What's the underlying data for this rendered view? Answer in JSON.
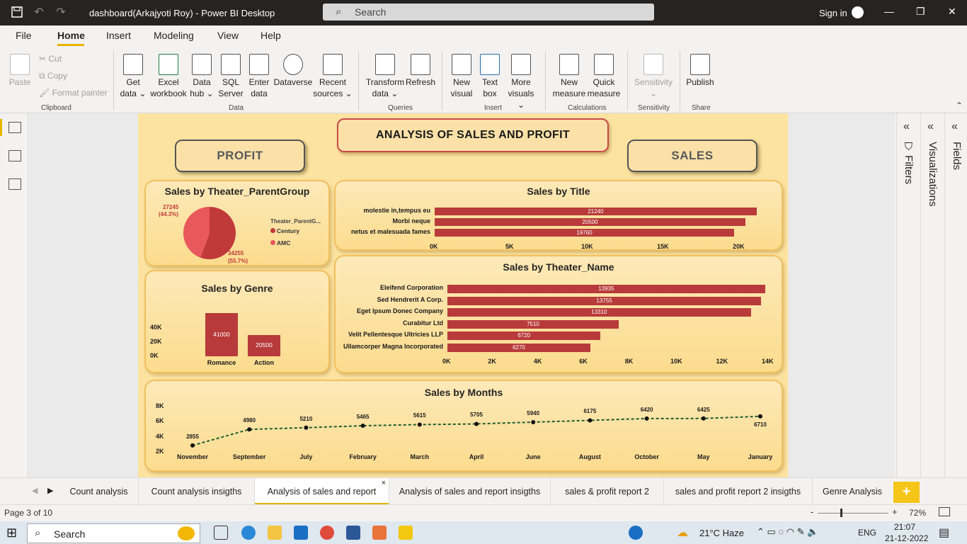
{
  "window": {
    "title": "dashboard(Arkajyoti Roy) - Power BI Desktop",
    "search_placeholder": "Search",
    "sign_in": "Sign in"
  },
  "menu": [
    "File",
    "Home",
    "Insert",
    "Modeling",
    "View",
    "Help"
  ],
  "ribbon": {
    "clipboard": {
      "paste": "Paste",
      "cut": "Cut",
      "copy": "Copy",
      "format_painter": "Format painter",
      "group": "Clipboard"
    },
    "data": {
      "get_data": [
        "Get",
        "data ⌄"
      ],
      "excel": [
        "Excel",
        "workbook"
      ],
      "data_hub": [
        "Data",
        "hub ⌄"
      ],
      "sql": [
        "SQL",
        "Server"
      ],
      "enter": [
        "Enter",
        "data"
      ],
      "dataverse": [
        "Dataverse",
        ""
      ],
      "recent": [
        "Recent",
        "sources ⌄"
      ],
      "group": "Data"
    },
    "queries": {
      "transform": [
        "Transform",
        "data ⌄"
      ],
      "refresh": [
        "Refresh",
        ""
      ],
      "group": "Queries"
    },
    "insert": {
      "new_visual": [
        "New",
        "visual"
      ],
      "text_box": [
        "Text",
        "box"
      ],
      "more_visuals": [
        "More",
        "visuals ⌄"
      ],
      "group": "Insert"
    },
    "calculations": {
      "new_measure": [
        "New",
        "measure"
      ],
      "quick_measure": [
        "Quick",
        "measure"
      ],
      "group": "Calculations"
    },
    "sensitivity": {
      "sensitivity": [
        "Sensitivity",
        "⌄"
      ],
      "group": "Sensitivity"
    },
    "share": {
      "publish": [
        "Publish",
        ""
      ],
      "group": "Share"
    }
  },
  "report": {
    "main_title": "ANALYSIS OF SALES AND PROFIT",
    "profit_button": "PROFIT",
    "sales_button": "SALES"
  },
  "colors": {
    "bar": "#b83a3a",
    "pie_century": "#c0393b",
    "pie_amc": "#e8585c",
    "line": "#1e5c2e",
    "accent": "#e8b500"
  },
  "pie_chart": {
    "title": "Sales by Theater_ParentGroup",
    "legend_title": "Theater_ParentG...",
    "slices": [
      {
        "name": "Century",
        "value": 34255,
        "pct_label": "(55.7%)",
        "value_label": "34255"
      },
      {
        "name": "AMC",
        "value": 27245,
        "pct_label": "(44.3%)",
        "value_label": "27245"
      }
    ]
  },
  "title_chart": {
    "title": "Sales by Title",
    "categories": [
      "molestie in,tempus eu",
      "Morbi neque",
      "netus et malesuada fames"
    ],
    "values": [
      21240,
      20500,
      19760
    ],
    "value_labels": [
      "21240",
      "20500",
      "19760"
    ],
    "ticks": [
      "0K",
      "5K",
      "10K",
      "15K",
      "20K"
    ],
    "xlim": [
      0,
      22000
    ]
  },
  "theater_chart": {
    "title": "Sales by Theater_Name",
    "categories": [
      "Eleifend Corporation",
      "Sed Hendrerit A Corp.",
      "Eget Ipsum Donec Company",
      "Curabitur Ltd",
      "Velit Pellentesque Ultricies LLP",
      "Ullamcorper Magna Incorporated"
    ],
    "values": [
      13935,
      13755,
      13310,
      7510,
      6720,
      6270
    ],
    "value_labels": [
      "13935",
      "13755",
      "13310",
      "7510",
      "6720",
      "6270"
    ],
    "ticks": [
      "0K",
      "2K",
      "4K",
      "6K",
      "8K",
      "10K",
      "12K",
      "14K"
    ],
    "xlim": [
      0,
      14000
    ]
  },
  "genre_chart": {
    "title": "Sales by Genre",
    "categories": [
      "Romance",
      "Action"
    ],
    "values": [
      41000,
      20500
    ],
    "value_labels": [
      "41000",
      "20500"
    ],
    "ticks": [
      "40K",
      "20K",
      "0K"
    ],
    "ylim": [
      0,
      55000
    ]
  },
  "months_chart": {
    "title": "Sales by Months",
    "categories": [
      "November",
      "September",
      "July",
      "February",
      "March",
      "April",
      "June",
      "August",
      "October",
      "May",
      "January"
    ],
    "values": [
      2855,
      4980,
      5210,
      5465,
      5615,
      5705,
      5940,
      6175,
      6420,
      6425,
      6710
    ],
    "value_labels": [
      "2855",
      "4980",
      "5210",
      "5465",
      "5615",
      "5705",
      "5940",
      "6175",
      "6420",
      "6425",
      "6710"
    ],
    "ticks": [
      "8K",
      "6K",
      "4K",
      "2K"
    ],
    "ylim": [
      2000,
      8000
    ]
  },
  "chart_data": [
    {
      "type": "pie",
      "title": "Sales by Theater_ParentGroup",
      "categories": [
        "Century",
        "AMC"
      ],
      "values": [
        34255,
        27245
      ]
    },
    {
      "type": "bar",
      "title": "Sales by Title",
      "categories": [
        "molestie in,tempus eu",
        "Morbi neque",
        "netus et malesuada fames"
      ],
      "values": [
        21240,
        20500,
        19760
      ]
    },
    {
      "type": "bar",
      "title": "Sales by Theater_Name",
      "categories": [
        "Eleifend Corporation",
        "Sed Hendrerit A Corp.",
        "Eget Ipsum Donec Company",
        "Curabitur Ltd",
        "Velit Pellentesque Ultricies LLP",
        "Ullamcorper Magna Incorporated"
      ],
      "values": [
        13935,
        13755,
        13310,
        7510,
        6720,
        6270
      ]
    },
    {
      "type": "bar",
      "title": "Sales by Genre",
      "categories": [
        "Romance",
        "Action"
      ],
      "values": [
        41000,
        20500
      ]
    },
    {
      "type": "line",
      "title": "Sales by Months",
      "categories": [
        "November",
        "September",
        "July",
        "February",
        "March",
        "April",
        "June",
        "August",
        "October",
        "May",
        "January"
      ],
      "values": [
        2855,
        4980,
        5210,
        5465,
        5615,
        5705,
        5940,
        6175,
        6420,
        6425,
        6710
      ]
    }
  ],
  "panes": {
    "filters": "Filters",
    "visualizations": "Visualizations",
    "fields": "Fields"
  },
  "tabs": [
    {
      "label": "Count analysis",
      "active": false
    },
    {
      "label": "Count analysis insigths",
      "active": false
    },
    {
      "label": "Analysis of sales and report",
      "active": true
    },
    {
      "label": "Analysis of sales and report insigths",
      "active": false
    },
    {
      "label": "sales & profit report 2",
      "active": false
    },
    {
      "label": "sales and profit report 2 insigths",
      "active": false
    },
    {
      "label": "Genre Analysis",
      "active": false
    }
  ],
  "status": {
    "page": "Page 3 of 10",
    "zoom": "72%"
  },
  "taskbar": {
    "search": "Search",
    "weather": "21°C  Haze",
    "lang": "ENG",
    "time": "21:07",
    "date": "21-12-2022"
  }
}
